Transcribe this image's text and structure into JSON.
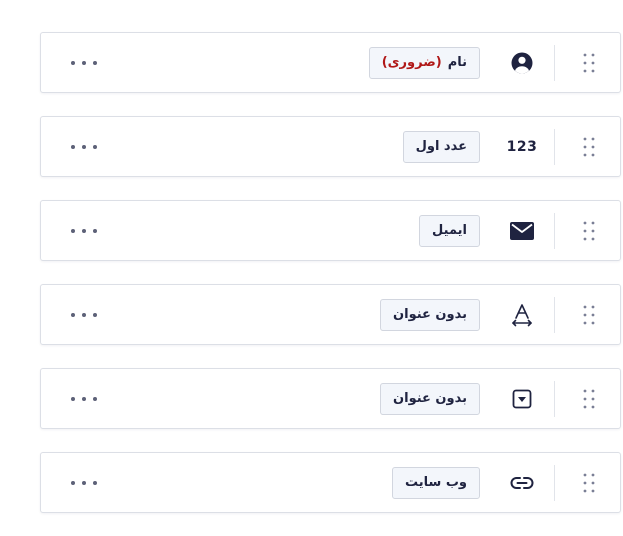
{
  "fields": [
    {
      "label": "نام",
      "required_text": "(ضروری)",
      "icon": "user-circle-icon",
      "icon_type": "user"
    },
    {
      "label": "عدد اول",
      "icon": "number-icon",
      "icon_type": "number",
      "icon_text": "123"
    },
    {
      "label": "ایمیل",
      "icon": "envelope-icon",
      "icon_type": "mail"
    },
    {
      "label": "بدون عنوان",
      "icon": "text-field-icon",
      "icon_type": "text"
    },
    {
      "label": "بدون عنوان",
      "icon": "dropdown-icon",
      "icon_type": "dropdown"
    },
    {
      "label": "وب سایت",
      "icon": "link-icon",
      "icon_type": "link"
    }
  ],
  "colors": {
    "text": "#1f2340",
    "required": "#b01818",
    "label_bg": "#f3f6fb",
    "border": "#dcdfe6"
  }
}
